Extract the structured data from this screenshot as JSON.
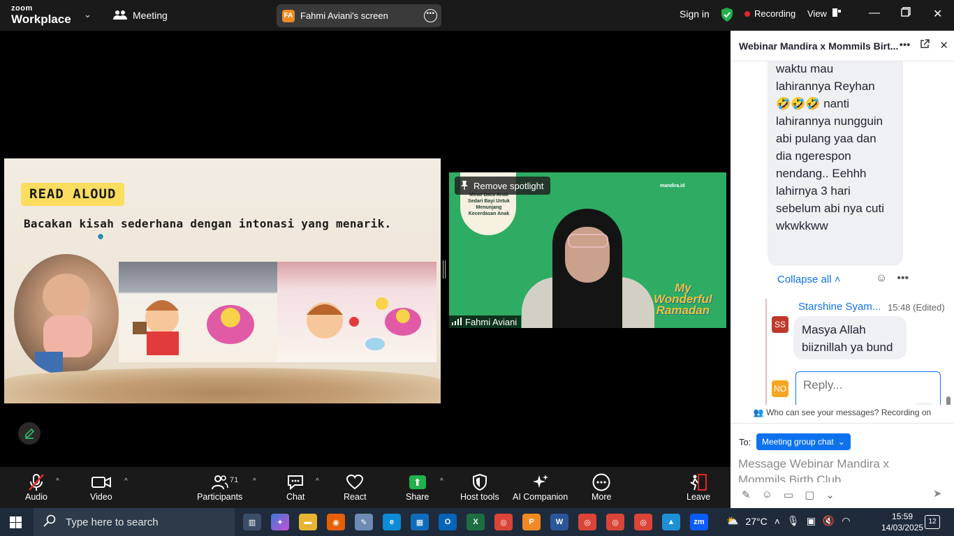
{
  "topbar": {
    "logo_top": "zoom",
    "logo_bottom": "Workplace",
    "meeting_label": "Meeting",
    "share_initials": "FA",
    "share_title": "Fahmi Aviani's screen",
    "sign_in": "Sign in",
    "recording": "Recording",
    "view": "View"
  },
  "slide": {
    "badge": "READ ALOUD",
    "subtitle": "Bacakan kisah sederhana dengan intonasi yang menarik."
  },
  "speaker": {
    "remove_spotlight": "Remove spotlight",
    "name": "Fahmi Aviani",
    "card_text": "Minat Baca Anak Sedari Bayi Untuk Menunjang Kecerdasan Anak",
    "brand": "mandira.id",
    "overlay_line1": "My",
    "overlay_line2": "Wonderful",
    "overlay_line3": "Ramadan"
  },
  "chat": {
    "title": "Webinar Mandira x Mommils Birt...",
    "long_message_lines": [
      "waktu mau",
      "lahirannya Reyhan",
      "🤣🤣🤣 nanti",
      "lahirannya nungguin",
      "abi pulang yaa dan",
      "dia ngerespon",
      "nendang.. Eehhh",
      "lahirnya 3 hari",
      "sebelum abi nya cuti",
      " wkwkkww"
    ],
    "collapse_all": "Collapse all",
    "reply_author_initials": "SS",
    "reply_author": "Starshine Syam...",
    "reply_time": "15:48 (Edited)",
    "reply_lines": [
      "Masya Allah",
      "biiznillah ya bund"
    ],
    "my_initials": "NO",
    "reply_placeholder": "Reply...",
    "who_can_see": "Who can see your messages? Recording on",
    "to_label": "To:",
    "to_value": "Meeting group chat",
    "message_placeholder_line1": "Message Webinar Mandira x",
    "message_placeholder_line2": "Mommils Birth Club"
  },
  "toolbar": {
    "audio": "Audio",
    "video": "Video",
    "participants": "Participants",
    "participants_count": "71",
    "chat": "Chat",
    "react": "React",
    "share": "Share",
    "host_tools": "Host tools",
    "ai_companion": "AI Companion",
    "more": "More",
    "leave": "Leave"
  },
  "taskbar": {
    "search_placeholder": "Type here to search",
    "temperature": "27°C",
    "time": "15:59",
    "date": "14/03/2025",
    "notifications": "12"
  },
  "colors": {
    "accent": "#0e72ed",
    "recording_red": "#e5262a",
    "share_green": "#22b14c",
    "speaker_bg": "#2eac63"
  }
}
